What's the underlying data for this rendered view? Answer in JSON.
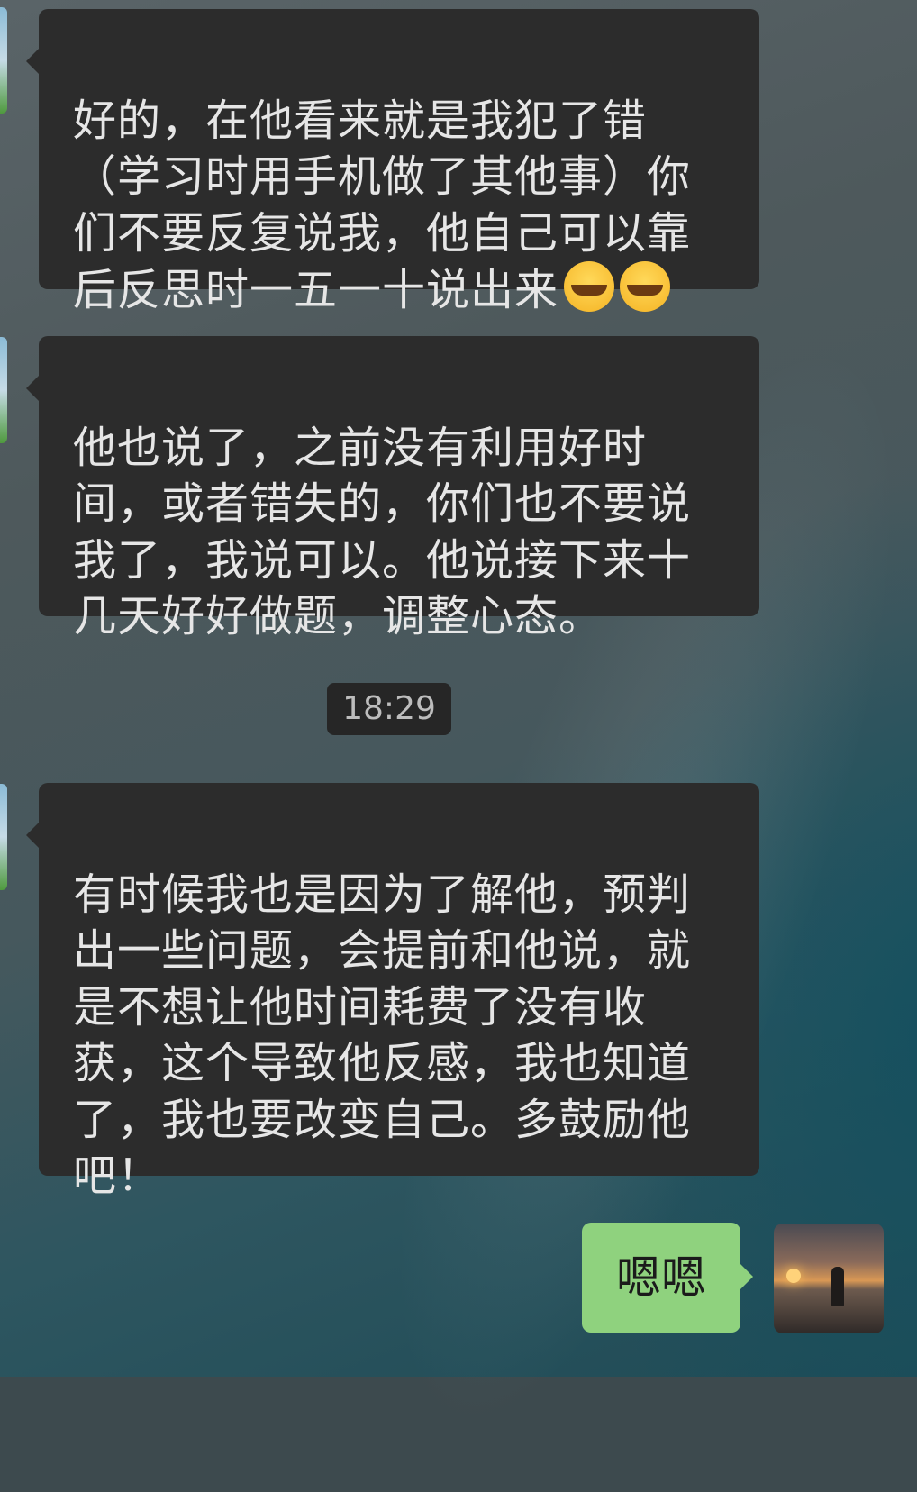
{
  "messages": [
    {
      "sender": "other",
      "text": "好的，在他看来就是我犯了错\n（学习时用手机做了其他事）你\n们不要反复说我，他自己可以靠\n后反思时一五一十说出来",
      "emoji": [
        "crying-laughing-icon",
        "crying-laughing-icon"
      ]
    },
    {
      "sender": "other",
      "text": "他也说了，之前没有利用好时\n间，或者错失的，你们也不要说\n我了，我说可以。他说接下来十\n几天好好做题，调整心态。"
    },
    {
      "sender": "other",
      "text": "有时候我也是因为了解他，预判\n出一些问题，会提前和他说，就\n是不想让他时间耗费了没有收\n获，这个导致他反感，我也知道\n了，我也要改变自己。多鼓励他\n吧！"
    },
    {
      "sender": "me",
      "text": "嗯嗯"
    }
  ],
  "timestamp": "18:29",
  "colors": {
    "incoming_bubble": "#2c2c2c",
    "outgoing_bubble": "#8fd27e",
    "timestamp_bg": "#262626"
  }
}
